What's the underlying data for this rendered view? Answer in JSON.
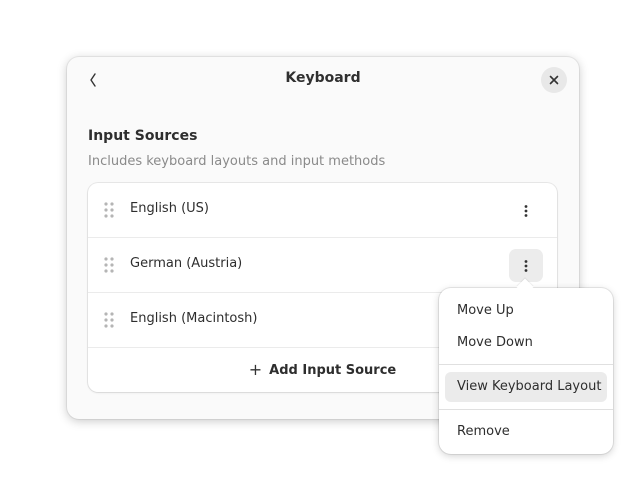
{
  "dialog": {
    "title": "Keyboard",
    "back_icon": "chevron-left-icon",
    "close_icon": "close-icon"
  },
  "section": {
    "title": "Input Sources",
    "subtitle": "Includes keyboard layouts and input methods"
  },
  "input_sources": [
    {
      "label": "English (US)"
    },
    {
      "label": "German (Austria)"
    },
    {
      "label": "English (Macintosh)"
    }
  ],
  "add_button": {
    "label": "Add Input Source",
    "icon": "plus-icon"
  },
  "context_menu": {
    "items": [
      {
        "label": "Move Up"
      },
      {
        "label": "Move Down"
      },
      {
        "label": "View Keyboard Layout"
      },
      {
        "label": "Remove"
      }
    ]
  },
  "colors": {
    "dialog_bg": "#fafafa",
    "list_bg": "#ffffff",
    "hover_bg": "#ebebeb"
  }
}
